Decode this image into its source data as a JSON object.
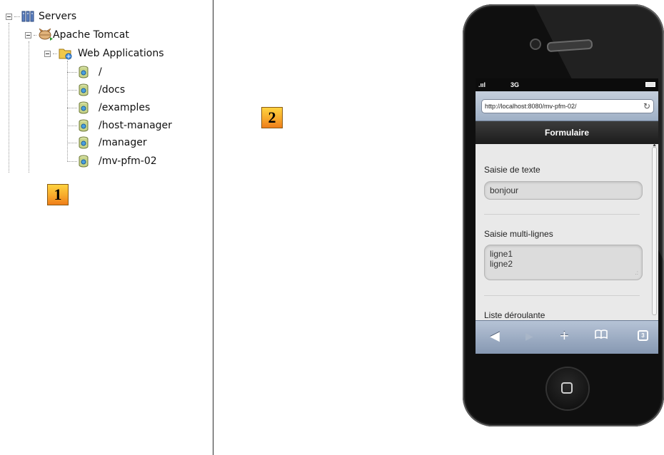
{
  "tree": {
    "root": {
      "label": "Servers",
      "icon": "servers-icon"
    },
    "server": {
      "label": "Apache Tomcat",
      "icon": "tomcat-icon"
    },
    "folder": {
      "label": "Web Applications",
      "icon": "web-applications-icon"
    },
    "apps": [
      {
        "label": "/",
        "icon": "webapp-icon"
      },
      {
        "label": "/docs",
        "icon": "webapp-icon"
      },
      {
        "label": "/examples",
        "icon": "webapp-icon"
      },
      {
        "label": "/host-manager",
        "icon": "webapp-icon"
      },
      {
        "label": "/manager",
        "icon": "webapp-icon"
      },
      {
        "label": "/mv-pfm-02",
        "icon": "webapp-icon"
      }
    ]
  },
  "badges": {
    "one": "1",
    "two": "2"
  },
  "phone": {
    "status": {
      "signal": ".ııl",
      "network": "3G"
    },
    "url": "http://localhost:8080/mv-pfm-02/",
    "header_title": "Formulaire",
    "form": {
      "text_label": "Saisie de texte",
      "text_value": "bonjour",
      "multiline_label": "Saisie multi-lignes",
      "multiline_line1": "ligne1",
      "multiline_line2": "ligne2",
      "dropdown_label": "Liste déroulante"
    },
    "toolbar": {
      "back": "◀",
      "forward": "▶",
      "add": "+",
      "bookmarks": "📖",
      "tabs_count": "3"
    }
  },
  "colors": {
    "badge_top": "#ffd23f",
    "badge_bottom": "#ef7d1a",
    "header_bar": "#1c1c1c",
    "toolbar": "#8597b1",
    "url_bar": "#9fb0c6"
  }
}
